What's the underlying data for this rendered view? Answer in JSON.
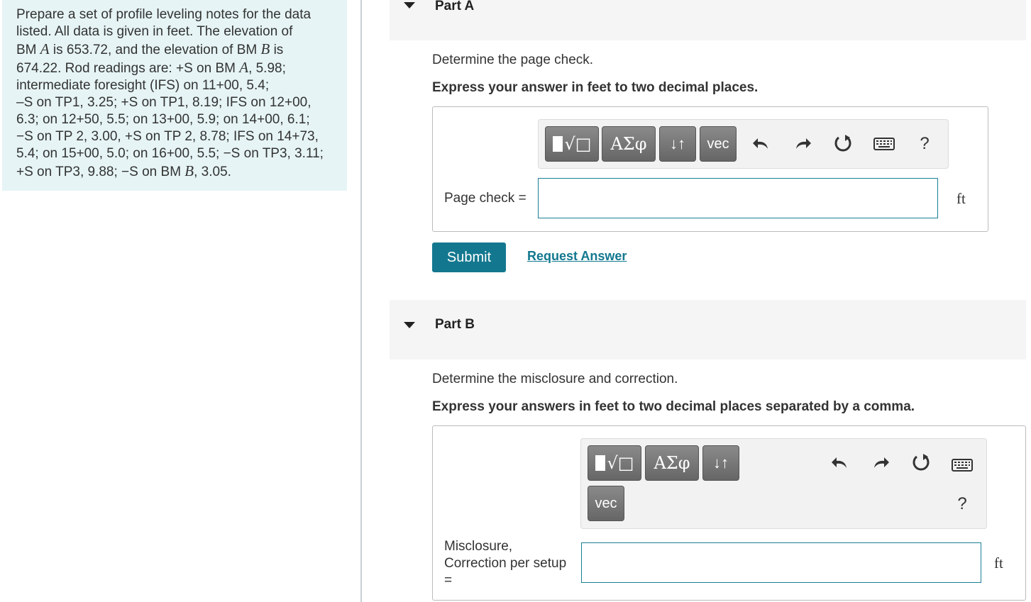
{
  "problem": {
    "lines": [
      [
        "Prepare a set of profile leveling notes for the data"
      ],
      [
        "listed. All data is given in feet. The elevation of"
      ],
      [
        "BM ",
        {
          "v": "A"
        },
        " is 653.72, and the elevation of BM ",
        {
          "v": "B"
        },
        " is"
      ],
      [
        "674.22. Rod readings are: +S on BM ",
        {
          "v": "A"
        },
        ", 5.98;"
      ],
      [
        "intermediate foresight (IFS) on 11+00, 5.4;"
      ],
      [
        "–S on TP1, 3.25; +S on TP1, 8.19; IFS on 12+00,"
      ],
      [
        "6.3; on 12+50, 5.5; on 13+00, 5.9; on 14+00, 6.1;"
      ],
      [
        "−S on TP 2, 3.00, +S on TP 2, 8.78; IFS on 14+73,"
      ],
      [
        "5.4; on 15+00, 5.0; on 16+00, 5.5; −S on TP3, 3.11;"
      ],
      [
        "+S on TP3, 9.88; −S on BM ",
        {
          "v": "B"
        },
        ", 3.05."
      ]
    ]
  },
  "partA": {
    "title": "Part A",
    "prompt": "Determine the page check.",
    "instruction": "Express your answer in feet to two decimal places.",
    "toolbar": {
      "greek": "ΑΣφ",
      "arrows": "↓↑",
      "vec": "vec",
      "help": "?"
    },
    "input_label": "Page check =",
    "input_value": "",
    "unit": "ft",
    "submit": "Submit",
    "request": "Request Answer"
  },
  "partB": {
    "title": "Part B",
    "prompt": "Determine the misclosure and correction.",
    "instruction": "Express your answers in feet to two decimal places separated by a comma.",
    "toolbar": {
      "greek": "ΑΣφ",
      "arrows": "↓↑",
      "vec": "vec",
      "help": "?"
    },
    "input_label_1": "Misclosure,",
    "input_label_2": "Correction per setup",
    "input_label_3": "=",
    "input_value": "",
    "unit": "ft"
  },
  "icons": {
    "templates": "sqrt-template-icon",
    "undo": "undo-icon",
    "redo": "redo-icon",
    "reset": "reset-icon",
    "keyboard": "keyboard-icon",
    "collapse": "collapse-triangle-icon"
  },
  "colors": {
    "accent": "#13788f",
    "problem_bg": "#e6f4f5",
    "part_header_bg": "#f5f5f5"
  }
}
